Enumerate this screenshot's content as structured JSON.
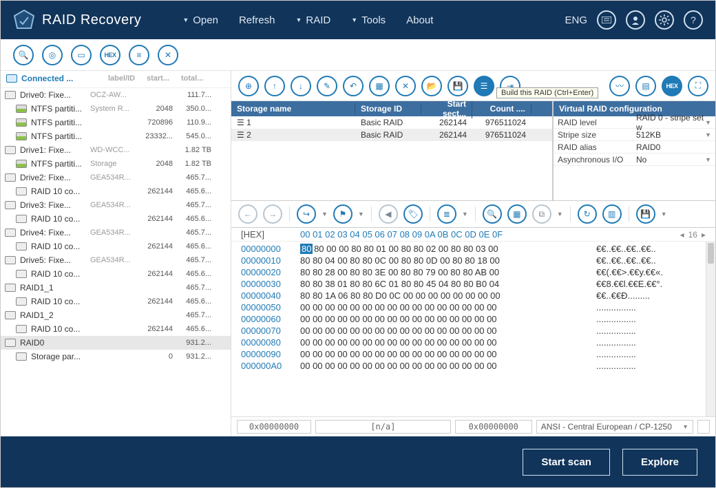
{
  "app": {
    "title": "RAID Recovery",
    "lang": "ENG"
  },
  "menu": {
    "open": "Open",
    "refresh": "Refresh",
    "raid": "RAID",
    "tools": "Tools",
    "about": "About"
  },
  "sidebar": {
    "header": {
      "connected": "Connected ...",
      "label": "label/ID",
      "start": "start...",
      "total": "total..."
    },
    "rows": [
      {
        "name": "Drive0: Fixe...",
        "label": "OCZ-AW...",
        "start": "",
        "size": "111.7...",
        "icon": "drive"
      },
      {
        "name": "NTFS partiti...",
        "label": "System R...",
        "start": "2048",
        "size": "350.0...",
        "icon": "part",
        "indent": true
      },
      {
        "name": "NTFS partiti...",
        "label": "",
        "start": "720896",
        "size": "110.9...",
        "icon": "part",
        "indent": true
      },
      {
        "name": "NTFS partiti...",
        "label": "",
        "start": "23332...",
        "size": "545.0...",
        "icon": "part",
        "indent": true
      },
      {
        "name": "Drive1: Fixe...",
        "label": "WD-WCC...",
        "start": "",
        "size": "1.82 TB",
        "icon": "drive"
      },
      {
        "name": "NTFS partiti...",
        "label": "Storage",
        "start": "2048",
        "size": "1.82 TB",
        "icon": "part",
        "indent": true
      },
      {
        "name": "Drive2: Fixe...",
        "label": "GEA534R...",
        "start": "",
        "size": "465.7...",
        "icon": "drive"
      },
      {
        "name": "RAID 10 co...",
        "label": "",
        "start": "262144",
        "size": "465.6...",
        "icon": "raid",
        "indent": true
      },
      {
        "name": "Drive3: Fixe...",
        "label": "GEA534R...",
        "start": "",
        "size": "465.7...",
        "icon": "drive"
      },
      {
        "name": "RAID 10 co...",
        "label": "",
        "start": "262144",
        "size": "465.6...",
        "icon": "raid",
        "indent": true
      },
      {
        "name": "Drive4: Fixe...",
        "label": "GEA534R...",
        "start": "",
        "size": "465.7...",
        "icon": "drive"
      },
      {
        "name": "RAID 10 co...",
        "label": "",
        "start": "262144",
        "size": "465.6...",
        "icon": "raid",
        "indent": true
      },
      {
        "name": "Drive5: Fixe...",
        "label": "GEA534R...",
        "start": "",
        "size": "465.7...",
        "icon": "drive"
      },
      {
        "name": "RAID 10 co...",
        "label": "",
        "start": "262144",
        "size": "465.6...",
        "icon": "raid",
        "indent": true
      },
      {
        "name": "RAID1_1",
        "label": "",
        "start": "",
        "size": "465.7...",
        "icon": "raid"
      },
      {
        "name": "RAID 10 co...",
        "label": "",
        "start": "262144",
        "size": "465.6...",
        "icon": "raid",
        "indent": true
      },
      {
        "name": "RAID1_2",
        "label": "",
        "start": "",
        "size": "465.7...",
        "icon": "raid"
      },
      {
        "name": "RAID 10 co...",
        "label": "",
        "start": "262144",
        "size": "465.6...",
        "icon": "raid",
        "indent": true
      },
      {
        "name": "RAID0",
        "label": "",
        "start": "",
        "size": "931.2...",
        "icon": "raid",
        "sel": true
      },
      {
        "name": "Storage par...",
        "label": "",
        "start": "0",
        "size": "931.2...",
        "icon": "raid",
        "indent": true
      }
    ]
  },
  "storageTable": {
    "headers": {
      "name": "Storage name",
      "id": "Storage ID",
      "start": "Start sect...",
      "count": "Count ...."
    },
    "rows": [
      {
        "name": "1",
        "id": "Basic RAID",
        "start": "262144",
        "count": "976511024"
      },
      {
        "name": "2",
        "id": "Basic RAID",
        "start": "262144",
        "count": "976511024",
        "sel": true
      }
    ]
  },
  "tooltip": "Build this RAID (Ctrl+Enter)",
  "config": {
    "header": "Virtual RAID configuration",
    "rows": [
      {
        "k": "RAID level",
        "v": "RAID 0 - stripe set w",
        "dd": true
      },
      {
        "k": "Stripe size",
        "v": "512KB",
        "dd": true
      },
      {
        "k": "RAID alias",
        "v": "RAID0"
      },
      {
        "k": "Asynchronous I/O",
        "v": "No",
        "dd": true
      }
    ]
  },
  "hex": {
    "label": "[HEX]",
    "cols": "00 01 02 03 04 05 06 07 08 09 0A 0B 0C 0D 0E 0F",
    "page": "16",
    "rows": [
      {
        "addr": "00000000",
        "firstByte": "80",
        "restBytes": " 80 00 00 80 80 01 00 80 80 02 00 80 80 03 00",
        "asc": "€€..€€..€€..€€.."
      },
      {
        "addr": "00000010",
        "bytes": "80 80 04 00 80 80 0C 00 80 80 0D 00 80 80 18 00",
        "asc": "€€..€€..€€..€€.."
      },
      {
        "addr": "00000020",
        "bytes": "80 80 28 00 80 80 3E 00 80 80 79 00 80 80 AB 00",
        "asc": "€€(.€€>.€€y.€€«."
      },
      {
        "addr": "00000030",
        "bytes": "80 80 38 01 80 80 6C 01 80 80 45 04 80 80 B0 04",
        "asc": "€€8.€€l.€€E.€€°."
      },
      {
        "addr": "00000040",
        "bytes": "80 80 1A 06 80 80 D0 0C 00 00 00 00 00 00 00 00",
        "asc": "€€..€€Đ........."
      },
      {
        "addr": "00000050",
        "bytes": "00 00 00 00 00 00 00 00 00 00 00 00 00 00 00 00",
        "asc": "................"
      },
      {
        "addr": "00000060",
        "bytes": "00 00 00 00 00 00 00 00 00 00 00 00 00 00 00 00",
        "asc": "................"
      },
      {
        "addr": "00000070",
        "bytes": "00 00 00 00 00 00 00 00 00 00 00 00 00 00 00 00",
        "asc": "................"
      },
      {
        "addr": "00000080",
        "bytes": "00 00 00 00 00 00 00 00 00 00 00 00 00 00 00 00",
        "asc": "................"
      },
      {
        "addr": "00000090",
        "bytes": "00 00 00 00 00 00 00 00 00 00 00 00 00 00 00 00",
        "asc": "................"
      },
      {
        "addr": "000000A0",
        "bytes": "00 00 00 00 00 00 00 00 00 00 00 00 00 00 00 00",
        "asc": "................"
      }
    ],
    "status": {
      "off1": "0x00000000",
      "off2": "[n/a]",
      "off3": "0x00000000",
      "enc": "ANSI - Central European / CP-1250"
    }
  },
  "footer": {
    "scan": "Start scan",
    "explore": "Explore"
  }
}
